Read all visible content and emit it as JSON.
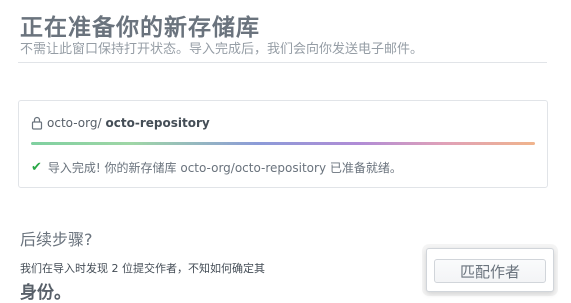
{
  "page": {
    "title": "正在准备你的新存储库",
    "subtitle": "不需让此窗口保持打开状态。导入完成后，我们会向你发送电子邮件。"
  },
  "import_card": {
    "repo_owner": "octo-org/",
    "repo_name": "octo-repository",
    "progress_percent": 100,
    "status_text": "导入完成! 你的新存储库 octo-org/octo-repository 已准备就绪。"
  },
  "next_steps": {
    "heading": "后续步骤?",
    "body": "我们在导入时发现 2 位提交作者，不知如何确定其",
    "body_tail": "身份。",
    "match_button_label": "匹配作者"
  },
  "icons": {
    "lock": "lock-icon",
    "check": "check-icon"
  },
  "colors": {
    "success": "#28a745",
    "muted": "#6a737d"
  }
}
